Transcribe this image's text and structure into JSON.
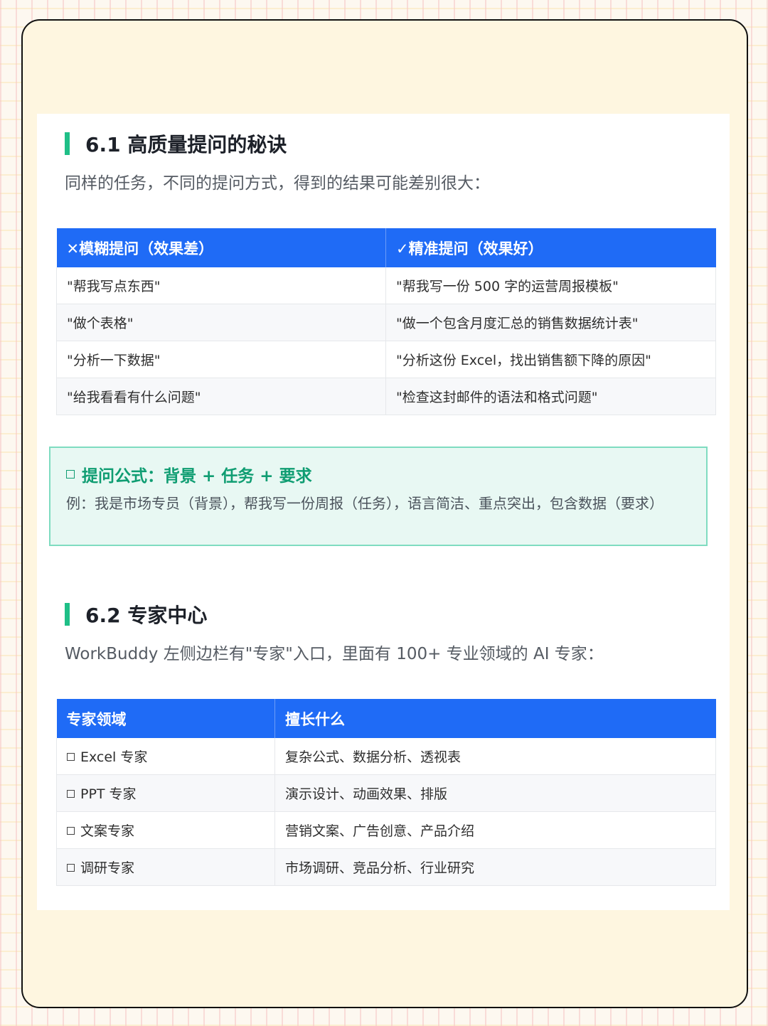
{
  "section1": {
    "title": "6.1 高质量提问的秘诀",
    "intro": "同样的任务，不同的提问方式，得到的结果可能差别很大：",
    "table": {
      "headers": [
        "✕模糊提问（效果差）",
        "✓精准提问（效果好）"
      ],
      "rows": [
        [
          "\"帮我写点东西\"",
          "\"帮我写一份 500 字的运营周报模板\""
        ],
        [
          "\"做个表格\"",
          "\"做一个包含月度汇总的销售数据统计表\""
        ],
        [
          "\"分析一下数据\"",
          "\"分析这份 Excel，找出销售额下降的原因\""
        ],
        [
          "\"给我看看有什么问题\"",
          "\"检查这封邮件的语法和格式问题\""
        ]
      ]
    },
    "tip": {
      "title": "提问公式：背景 + 任务 + 要求",
      "body": "例：我是市场专员（背景），帮我写一份周报（任务），语言简洁、重点突出，包含数据（要求）"
    }
  },
  "section2": {
    "title": "6.2 专家中心",
    "intro": "WorkBuddy 左侧边栏有\"专家\"入口，里面有 100+ 专业领域的 AI 专家：",
    "table": {
      "headers": [
        "专家领域",
        "擅长什么"
      ],
      "rows": [
        [
          "Excel 专家",
          "复杂公式、数据分析、透视表"
        ],
        [
          "PPT 专家",
          "演示设计、动画效果、排版"
        ],
        [
          "文案专家",
          "营销文案、广告创意、产品介绍"
        ],
        [
          "调研专家",
          "市场调研、竞品分析、行业研究"
        ]
      ]
    }
  }
}
